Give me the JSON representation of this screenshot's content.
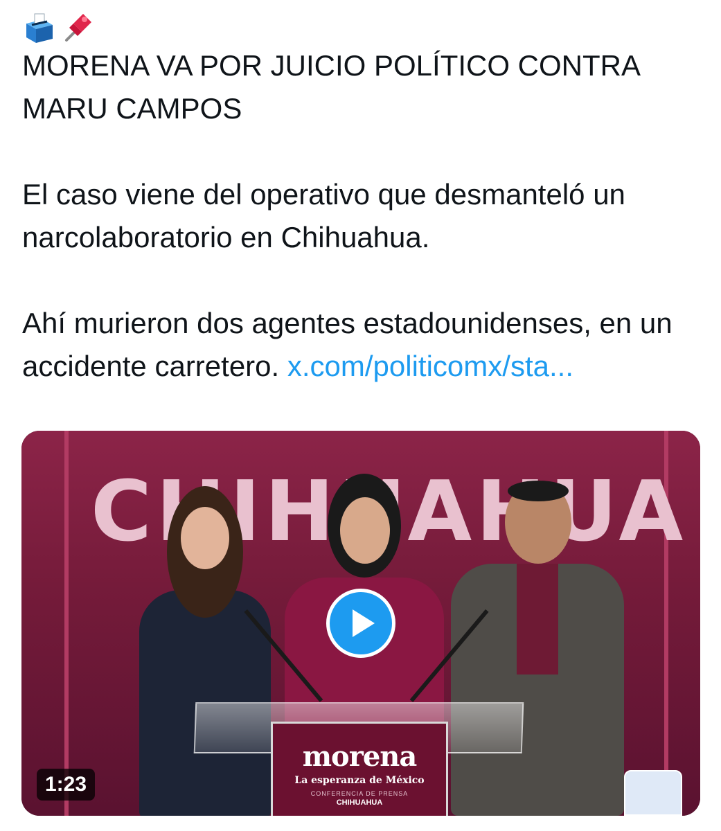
{
  "tweet": {
    "headline": "MORENA VA POR JUICIO POLÍTICO CONTRA MARU CAMPOS",
    "headline_icons": [
      "ballot-box-icon",
      "pushpin-icon"
    ],
    "paragraph_1": "El caso viene del operativo que desmanteló un narcolaboratorio en Chihuahua.",
    "paragraph_2": "Ahí murieron dos agentes estadounidenses, en un accidente carretero.",
    "link_text": "x.com/politicomx/sta..."
  },
  "media": {
    "backdrop_text": "CHIHUAHUA",
    "podium_brand": "morena",
    "podium_tagline": "La esperanza de México",
    "podium_subtitle": "CONFERENCIA DE PRENSA",
    "podium_city": "CHIHUAHUA",
    "duration": "1:23"
  },
  "colors": {
    "link": "#1d9bf0",
    "play_button": "#1d9bf0",
    "brand_maroon": "#751b3a"
  }
}
